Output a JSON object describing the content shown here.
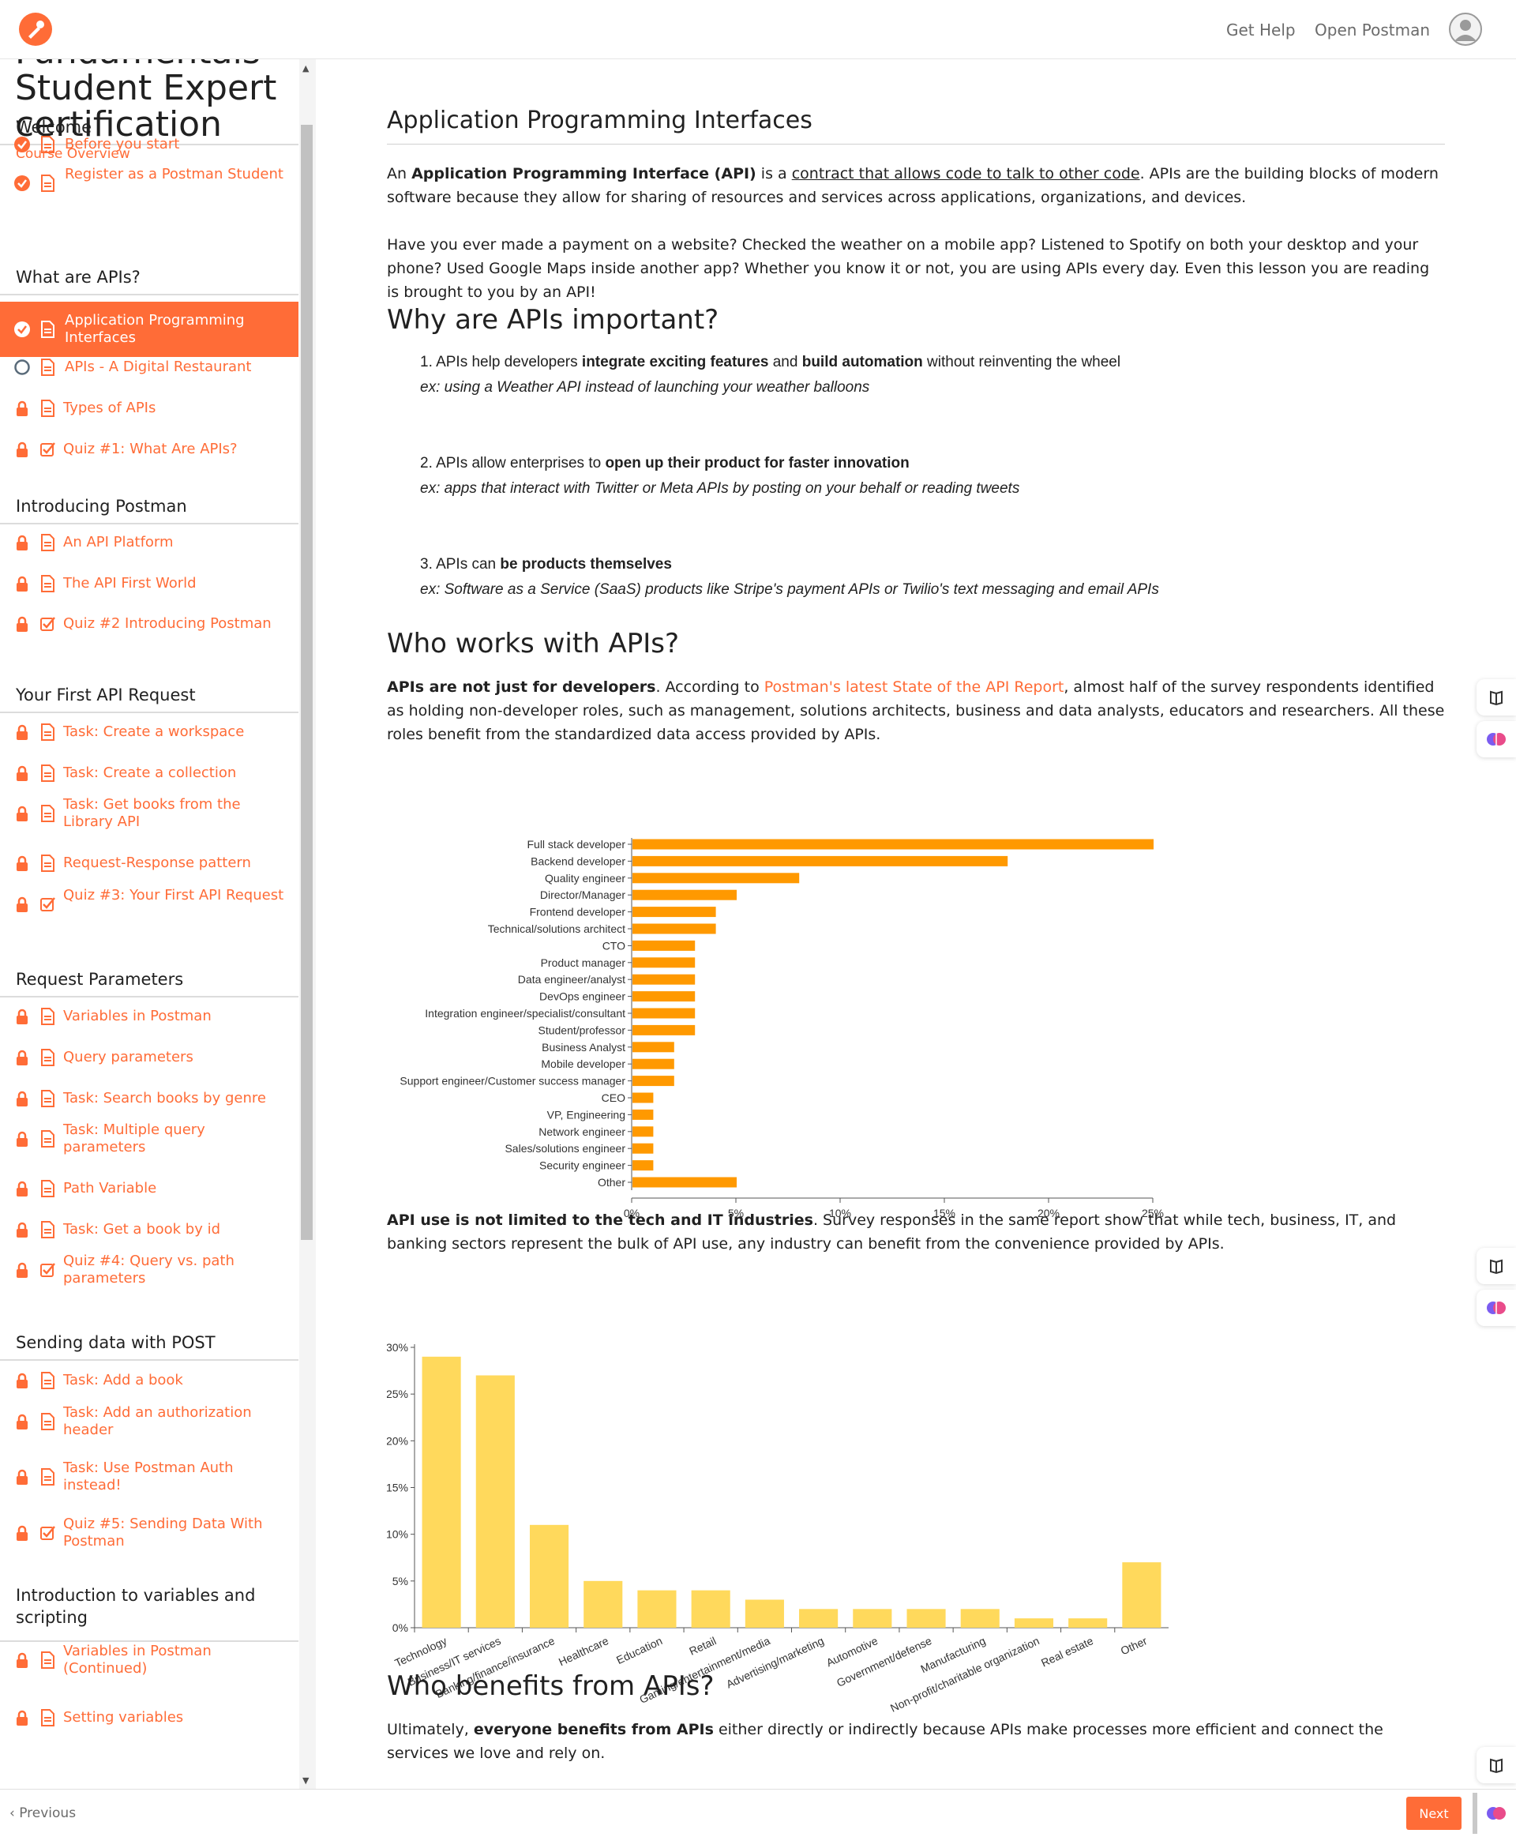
{
  "header": {
    "get_help": "Get Help",
    "open_postman": "Open Postman"
  },
  "sidebar": {
    "course_title_line1": "Fundamentals",
    "course_title_line2": "Student Expert",
    "course_title_line3": "certification",
    "course_overview": "Course Overview",
    "sections": [
      {
        "title": "Welcome",
        "lessons": [
          {
            "label": "Before you start",
            "status": "done",
            "kind": "doc"
          },
          {
            "label": "Register as a Postman Student",
            "status": "done",
            "kind": "doc"
          }
        ]
      },
      {
        "title": "What are APIs?",
        "lessons": [
          {
            "label": "Application Programming Interfaces",
            "status": "done",
            "kind": "doc",
            "active": true
          },
          {
            "label": "APIs - A Digital Restaurant",
            "status": "open",
            "kind": "doc"
          },
          {
            "label": "Types of APIs",
            "status": "locked",
            "kind": "doc"
          },
          {
            "label": "Quiz #1: What Are APIs?",
            "status": "locked",
            "kind": "quiz"
          }
        ]
      },
      {
        "title": "Introducing Postman",
        "lessons": [
          {
            "label": "An API Platform",
            "status": "locked",
            "kind": "doc"
          },
          {
            "label": "The API First World",
            "status": "locked",
            "kind": "doc"
          },
          {
            "label": "Quiz #2 Introducing Postman",
            "status": "locked",
            "kind": "quiz"
          }
        ]
      },
      {
        "title": "Your First API Request",
        "lessons": [
          {
            "label": "Task: Create a workspace",
            "status": "locked",
            "kind": "doc"
          },
          {
            "label": "Task: Create a collection",
            "status": "locked",
            "kind": "doc"
          },
          {
            "label": "Task: Get books from the Library API",
            "status": "locked",
            "kind": "doc"
          },
          {
            "label": "Request-Response pattern",
            "status": "locked",
            "kind": "doc"
          },
          {
            "label": "Quiz #3: Your First API Request",
            "status": "locked",
            "kind": "quiz"
          }
        ]
      },
      {
        "title": "Request Parameters",
        "lessons": [
          {
            "label": "Variables in Postman",
            "status": "locked",
            "kind": "doc"
          },
          {
            "label": "Query parameters",
            "status": "locked",
            "kind": "doc"
          },
          {
            "label": "Task: Search books by genre",
            "status": "locked",
            "kind": "doc"
          },
          {
            "label": "Task: Multiple query parameters",
            "status": "locked",
            "kind": "doc"
          },
          {
            "label": "Path Variable",
            "status": "locked",
            "kind": "doc"
          },
          {
            "label": "Task: Get a book by id",
            "status": "locked",
            "kind": "doc"
          },
          {
            "label": "Quiz #4: Query vs. path parameters",
            "status": "locked",
            "kind": "quiz"
          }
        ]
      },
      {
        "title": "Sending data with POST",
        "lessons": [
          {
            "label": "Task: Add a book",
            "status": "locked",
            "kind": "doc"
          },
          {
            "label": "Task: Add an authorization header",
            "status": "locked",
            "kind": "doc"
          },
          {
            "label": "Task: Use Postman Auth instead!",
            "status": "locked",
            "kind": "doc"
          },
          {
            "label": "Quiz #5: Sending Data With Postman",
            "status": "locked",
            "kind": "quiz"
          }
        ]
      },
      {
        "title": "Introduction to variables and scripting",
        "lessons": [
          {
            "label": "Variables in Postman (Continued)",
            "status": "locked",
            "kind": "doc"
          },
          {
            "label": "Setting variables",
            "status": "locked",
            "kind": "doc"
          }
        ]
      }
    ]
  },
  "content": {
    "page_title": "Application Programming Interfaces",
    "intro": {
      "a": "An ",
      "b_api": "Application Programming Interface (API)",
      "c": " is a ",
      "link": "contract that allows code to talk to other code",
      "d": ". APIs are the building blocks of modern software because they allow for sharing of resources and services across applications, organizations, and devices."
    },
    "intro2": "Have you ever made a payment on a website? Checked the weather on a mobile app? Listened to Spotify on both your desktop and your phone? Used Google Maps inside another app? Whether you know it or not, you are using APIs every day. Even this lesson you are reading is brought to you by an API!",
    "why_title": "Why are APIs important?",
    "why_items": [
      {
        "n": "1. ",
        "a": "APIs help developers ",
        "b1": "integrate exciting features",
        "c": " and ",
        "b2": "build automation",
        "d": " without reinventing the wheel",
        "ex": "ex: using a Weather API instead of launching your weather balloons"
      },
      {
        "n": "2. ",
        "a": "APIs allow enterprises to ",
        "b1": "open up their product for faster innovation",
        "c": "",
        "b2": "",
        "d": "",
        "ex": "ex: apps that interact with Twitter or Meta APIs by posting on your behalf or reading tweets"
      },
      {
        "n": "3. ",
        "a": "APIs can ",
        "b1": "be products themselves",
        "c": "",
        "b2": "",
        "d": "",
        "ex": "ex: Software as a Service (SaaS) products like Stripe's payment APIs or Twilio's text messaging and email APIs"
      }
    ],
    "who_title": "Who works with APIs?",
    "who_para": {
      "b": "APIs are not just for developers",
      "a": ". According to ",
      "link": "Postman's latest State of the API Report",
      "c": ", almost half of the survey respondents identified as holding non-developer roles, such as management, solutions architects, business and data analysts, educators and researchers. All these roles benefit from the standardized data access provided by APIs."
    },
    "industry_para": {
      "b": "API use is not limited to the tech and IT industries",
      "a": ". Survey responses in the same report show that while tech, business, IT, and banking sectors represent the bulk of API use, any industry can benefit from the convenience provided by APIs."
    },
    "benefits_title": "Who benefits from APIs?",
    "benefits_para": {
      "a": "Ultimately, ",
      "b": "everyone benefits from APIs",
      "c": " either directly or indirectly because APIs make processes more efficient and connect the services we love and rely on."
    }
  },
  "chart_data": [
    {
      "type": "bar",
      "orientation": "horizontal",
      "color": "#ff9900",
      "categories": [
        "Full stack developer",
        "Backend developer",
        "Quality engineer",
        "Director/Manager",
        "Frontend developer",
        "Technical/solutions architect",
        "CTO",
        "Product manager",
        "Data engineer/analyst",
        "DevOps engineer",
        "Integration engineer/specialist/consultant",
        "Student/professor",
        "Business Analyst",
        "Mobile developer",
        "Support engineer/Customer success manager",
        "CEO",
        "VP, Engineering",
        "Network engineer",
        "Sales/solutions engineer",
        "Security engineer",
        "Other"
      ],
      "values": [
        25,
        18,
        8,
        5,
        4,
        4,
        3,
        3,
        3,
        3,
        3,
        3,
        2,
        2,
        2,
        1,
        1,
        1,
        1,
        1,
        5
      ],
      "xticks": [
        "0%",
        "5%",
        "10%",
        "15%",
        "20%",
        "25%"
      ],
      "xlim": [
        0,
        25
      ]
    },
    {
      "type": "bar",
      "orientation": "vertical",
      "color": "#ffd95c",
      "categories": [
        "Technology",
        "Business/IT services",
        "Banking/finance/insurance",
        "Healthcare",
        "Education",
        "Retail",
        "Gaming/entertainment/media",
        "Advertising/marketing",
        "Automotive",
        "Government/defense",
        "Manufacturing",
        "Non-profit/charitable organization",
        "Real estate",
        "Other"
      ],
      "values": [
        29,
        27,
        11,
        5,
        4,
        4,
        3,
        2,
        2,
        2,
        2,
        1,
        1,
        7
      ],
      "yticks": [
        "0%",
        "5%",
        "10%",
        "15%",
        "20%",
        "25%",
        "30%"
      ],
      "ylim": [
        0,
        30
      ]
    }
  ],
  "footer": {
    "previous": "Previous",
    "next": "Next"
  },
  "icons": {
    "done": "check-circle-icon",
    "open": "circle-outline-icon",
    "locked": "lock-icon",
    "doc": "document-icon",
    "quiz": "checkbox-icon"
  },
  "colors": {
    "accent": "#ff6c37"
  }
}
